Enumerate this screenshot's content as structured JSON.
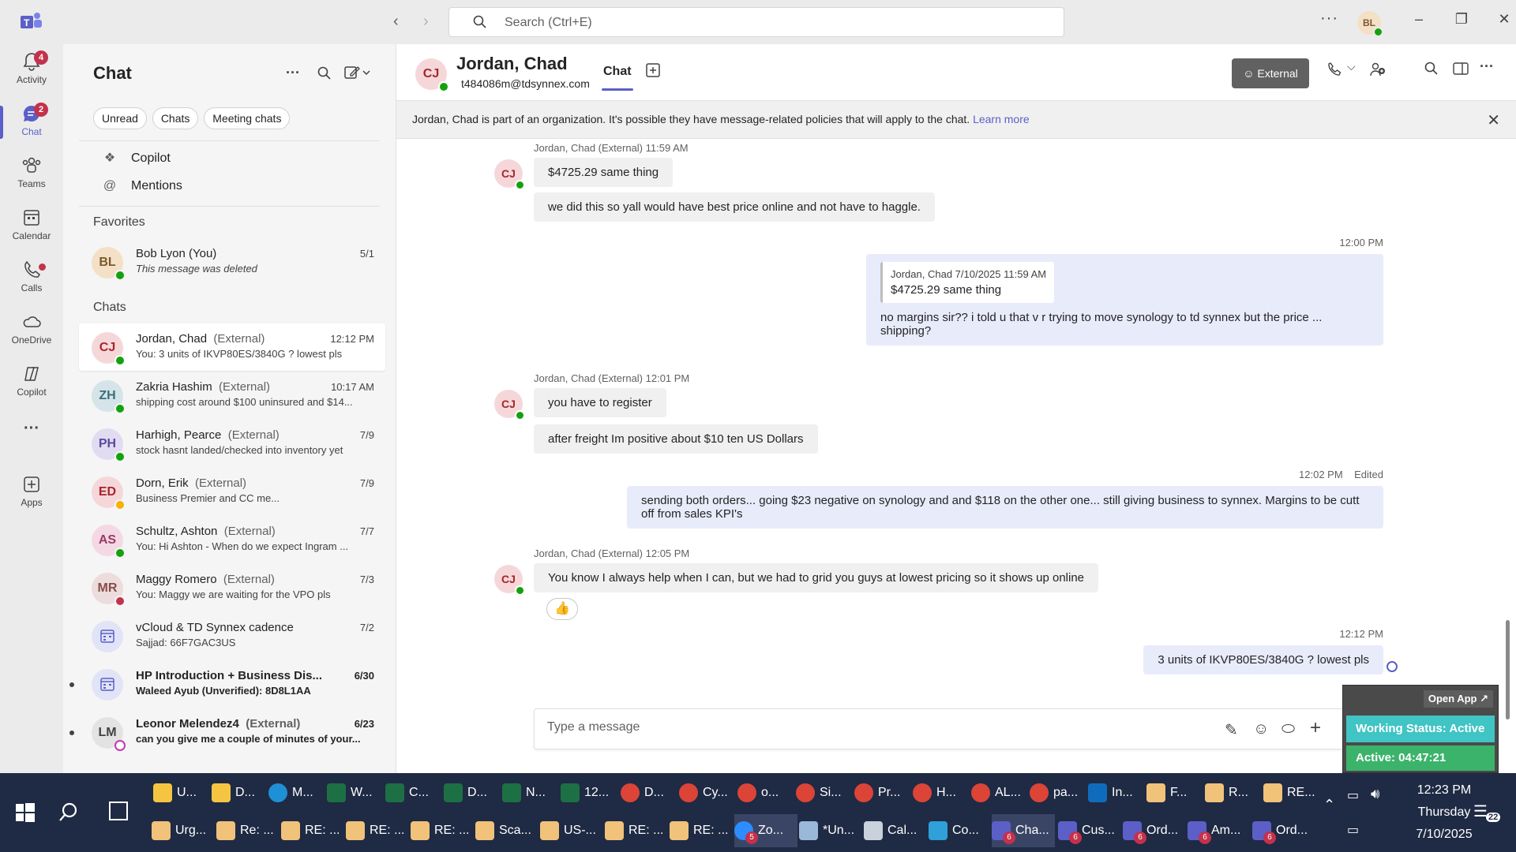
{
  "titlebar": {
    "search_placeholder": "Search (Ctrl+E)",
    "avatar_initials": "BL"
  },
  "rail": [
    {
      "label": "Activity",
      "badge": "4"
    },
    {
      "label": "Chat",
      "badge": "2"
    },
    {
      "label": "Teams"
    },
    {
      "label": "Calendar"
    },
    {
      "label": "Calls"
    },
    {
      "label": "OneDrive"
    },
    {
      "label": "Copilot"
    },
    {
      "label": "Apps"
    }
  ],
  "chatlist": {
    "title": "Chat",
    "filters": [
      "Unread",
      "Chats",
      "Meeting chats"
    ],
    "quick_links": [
      "Copilot",
      "Mentions"
    ],
    "favorites_header": "Favorites",
    "favorites": [
      {
        "initials": "BL",
        "name": "Bob Lyon (You)",
        "preview": "This message was deleted",
        "time": "5/1"
      }
    ],
    "chats_header": "Chats",
    "chats": [
      {
        "initials": "CJ",
        "name": "Jordan, Chad",
        "ext": "(External)",
        "preview": "You: 3 units of IKVP80ES/3840G ? lowest pls",
        "time": "12:12 PM"
      },
      {
        "initials": "ZH",
        "name": "Zakria Hashim",
        "ext": "(External)",
        "preview": "shipping cost around $100 uninsured and $14...",
        "time": "10:17 AM"
      },
      {
        "initials": "PH",
        "name": "Harhigh, Pearce",
        "ext": "(External)",
        "preview": "stock hasnt landed/checked into inventory yet",
        "time": "7/9"
      },
      {
        "initials": "ED",
        "name": "Dorn, Erik",
        "ext": "(External)",
        "preview": "Business Premier and CC me...",
        "time": "7/9"
      },
      {
        "initials": "AS",
        "name": "Schultz, Ashton",
        "ext": "(External)",
        "preview": "You: Hi Ashton -  When do we expect Ingram ...",
        "time": "7/7"
      },
      {
        "initials": "MR",
        "name": "Maggy Romero",
        "ext": "(External)",
        "preview": "You: Maggy we are waiting for the VPO pls",
        "time": "7/3"
      },
      {
        "initials": "",
        "name": "vCloud & TD Synnex cadence",
        "ext": "",
        "preview": "Sajjad: 66F7GAC3US",
        "time": "7/2"
      },
      {
        "initials": "",
        "name": "HP Introduction + Business Dis...",
        "ext": "",
        "preview": "Waleed Ayub (Unverified): 8D8L1AA",
        "time": "6/30"
      },
      {
        "initials": "LM",
        "name": "Leonor Melendez4",
        "ext": "(External)",
        "preview": "can you give me a couple of minutes of your...",
        "time": "6/23"
      }
    ]
  },
  "header": {
    "initials": "CJ",
    "name": "Jordan, Chad",
    "email": "t484086m@tdsynnex.com",
    "tab": "Chat",
    "external_label": "External"
  },
  "banner": {
    "text": "Jordan, Chad is part of an organization. It's possible they have message-related policies that will apply to the chat.",
    "link": "Learn more"
  },
  "messages": {
    "g1_meta": "Jordan, Chad (External)   11:59 AM",
    "g1_m1": "$4725.29 same thing",
    "g1_m2": "we did this so yall would have best price online and not have to haggle.",
    "o1_time": "12:00 PM",
    "o1_quote_meta": "Jordan, Chad   7/10/2025 11:59 AM",
    "o1_quote_text": "$4725.29 same thing",
    "o1_text": "no margins sir?? i told u that v r trying to move synology to td synnex but the price ... shipping?",
    "g2_meta": "Jordan, Chad (External)   12:01 PM",
    "g2_m1": "you have to register",
    "g2_m2": "after freight Im positive about $10 ten US Dollars",
    "o2_time": "12:02 PM",
    "o2_edited": "Edited",
    "o2_text": "sending both orders... going $23 negative on synology and and $118 on the other one... still giving business to synnex. Margins to be cutt off from sales KPI's",
    "g3_meta": "Jordan, Chad (External)   12:05 PM",
    "g3_m1": "You know I always help when I can, but we had to grid you guys at lowest pricing so it shows up online",
    "g3_reaction": "👍",
    "o3_time": "12:12 PM",
    "o3_text": "3 units of IKVP80ES/3840G ? lowest pls"
  },
  "composer": {
    "placeholder": "Type a message"
  },
  "widget": {
    "open_app": "Open App ↗",
    "working_status": "Working Status: Active",
    "active_time": "Active: 04:47:21"
  },
  "taskbar": {
    "row1": [
      "U...",
      "D...",
      "M...",
      "W...",
      "C...",
      "D...",
      "N...",
      "12...",
      "D...",
      "Cy...",
      "o...",
      "Si...",
      "Pr...",
      "H...",
      "AL...",
      "pa...",
      "In...",
      "F...",
      "R...",
      "RE..."
    ],
    "row2": [
      "Urg...",
      "Re: ...",
      "RE: ...",
      "RE: ...",
      "RE: ...",
      "Sca...",
      "US-...",
      "RE: ...",
      "RE: ...",
      "Zo...",
      "*Un...",
      "Cal...",
      "Co...",
      "Cha...",
      "Cus...",
      "Ord...",
      "Am...",
      "Ord..."
    ],
    "time": "12:23 PM",
    "day": "Thursday",
    "date": "7/10/2025",
    "notifications": "22"
  },
  "colors": {
    "accent": "#5b5fc7",
    "available": "#13a10e",
    "busy": "#c4314b",
    "away": "#f8b100"
  }
}
